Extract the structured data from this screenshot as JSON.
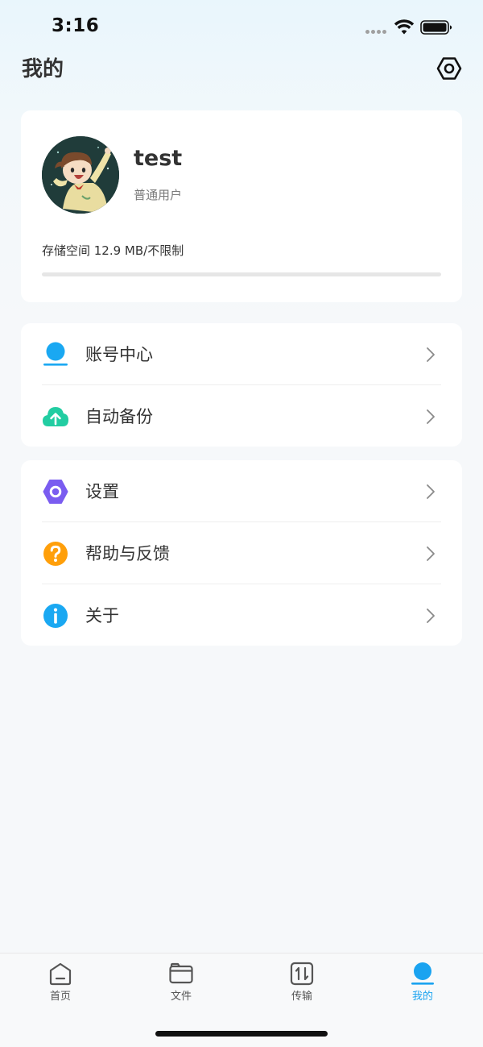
{
  "status_bar": {
    "time": "3:16"
  },
  "header": {
    "title": "我的",
    "settings_icon": "hexagon-settings-icon"
  },
  "profile": {
    "username": "test",
    "role": "普通用户",
    "storage_label": "存储空间 12.9 MB/不限制",
    "storage_used_fraction": 0.0
  },
  "menu_groups": [
    {
      "items": [
        {
          "label": "账号中心",
          "icon": "account-icon",
          "color": "#1aa8f2"
        },
        {
          "label": "自动备份",
          "icon": "cloud-upload-icon",
          "color": "#22cda2"
        }
      ]
    },
    {
      "items": [
        {
          "label": "设置",
          "icon": "settings-icon",
          "color": "#7a5cf0"
        },
        {
          "label": "帮助与反馈",
          "icon": "help-icon",
          "color": "#ff9f0a"
        },
        {
          "label": "关于",
          "icon": "info-icon",
          "color": "#1aa8f2"
        }
      ]
    }
  ],
  "tab_bar": {
    "tabs": [
      {
        "label": "首页",
        "icon": "home-icon"
      },
      {
        "label": "文件",
        "icon": "folder-icon"
      },
      {
        "label": "传输",
        "icon": "transfer-icon"
      },
      {
        "label": "我的",
        "icon": "profile-icon",
        "active": true
      }
    ]
  },
  "colors": {
    "accent": "#1aa3f0",
    "text_primary": "#333333",
    "text_secondary": "#7a7a7a",
    "card_bg": "#ffffff",
    "page_bg": "#f6f8fa"
  }
}
